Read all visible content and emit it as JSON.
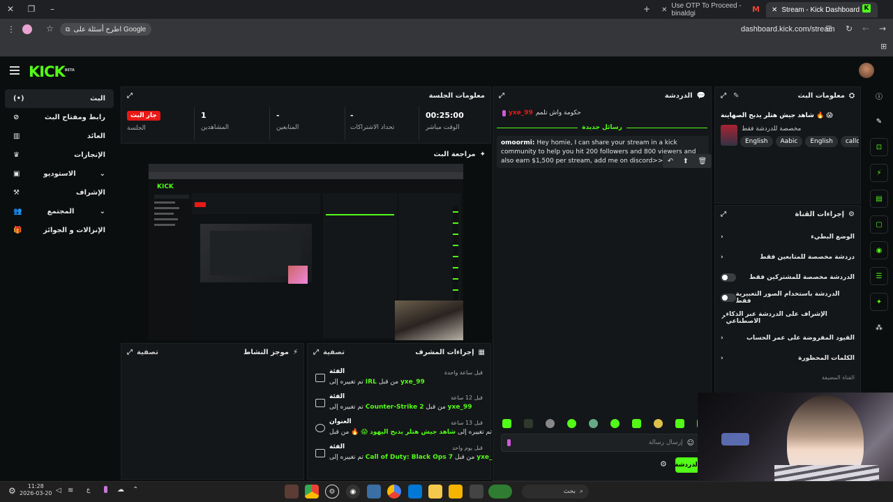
{
  "browser": {
    "tabs": [
      {
        "title": "Use OTP To Proceed - binaldgi"
      },
      {
        "title": "Stream - Kick Dashboard"
      }
    ],
    "google_chip": "اطرح أسئلة على Google",
    "url": "dashboard.kick.com/stream"
  },
  "brand": {
    "logo": "KICK",
    "beta": "BETA",
    "accent": "#53fc18"
  },
  "sidebar": {
    "items": [
      {
        "label": "البث",
        "icon": "broadcast-icon"
      },
      {
        "label": "رابط ومفتاح البث",
        "icon": "link-icon"
      },
      {
        "label": "العائد",
        "icon": "revenue-icon"
      },
      {
        "label": "الإنجازات",
        "icon": "trophy-icon"
      },
      {
        "label": "الاستوديو",
        "icon": "studio-icon"
      },
      {
        "label": "الإشراف",
        "icon": "gavel-icon"
      },
      {
        "label": "المجتمع",
        "icon": "community-icon"
      },
      {
        "label": "الإنزالات و الجوائز",
        "icon": "gift-icon"
      }
    ]
  },
  "session": {
    "title": "معلومات الجلسة",
    "live_badge": "جار البث",
    "session_label": "الجلسة",
    "viewers_value": "1",
    "viewers_label": "المشاهدين",
    "followers_value": "-",
    "followers_label": "المتابعين",
    "subs_value": "-",
    "subs_label": "تحداد الاشتراكات",
    "time_value": "00:25:00",
    "time_label": "الوقت مباشر"
  },
  "preview": {
    "title": "مراجعة البث"
  },
  "activity": {
    "title": "موجز النشاط",
    "filter": "تصفية"
  },
  "mod_actions": {
    "title": "إجراءات المشرف",
    "filter": "تصفية",
    "rows": [
      {
        "heading": "الفئة",
        "time": "قبل ساعة واحدة",
        "prefix": "تم تغييره إلى",
        "value": "IRL",
        "by": "من قبل",
        "user": "yxe_99"
      },
      {
        "heading": "الفئة",
        "time": "قبل 12 ساعة",
        "prefix": "تم تغييره إلى",
        "value": "Counter-Strike 2",
        "by": "من قبل",
        "user": "yxe_99"
      },
      {
        "heading": "العنوان",
        "time": "قبل 13 ساعة",
        "prefix": "تم تغييره إلى",
        "value": "شاهد جيش هتلر يذبح اليهود 😱 🔥",
        "by": "من قبل",
        "user": "yxe_99"
      },
      {
        "heading": "الفئة",
        "time": "قبل يوم واحد",
        "prefix": "تم تغييره إلى",
        "value": "Call of Duty: Black Ops 7",
        "by": "من قبل",
        "user": "yxe_99"
      }
    ]
  },
  "chat": {
    "title": "الدردشة",
    "first_user": "yxe_99",
    "first_msg": "حكومة واش تلمم",
    "new_messages": "رسائل جديدة",
    "msg_user": "omoormi:",
    "msg_text": "Hey homie, I can share your stream in a kick community to help you hit 200 followers and 800 viewers and also earn $1,500 per stream, add me on discord>>> done_111",
    "input_placeholder": "إرسال رسالة",
    "send_label": "الدردشة"
  },
  "stream_info": {
    "title": "معلومات البث",
    "stream_title": "شاهد جيش هتلر يذبح الصهاينة 🔥 😱",
    "subtitle": "مخصصة للدردشة فقط",
    "tags": [
      "English",
      "Aabic",
      "English",
      "callo"
    ]
  },
  "channel_actions": {
    "title": "إجراءات القناة",
    "items": [
      {
        "label": "الوضع البطيء",
        "control": "chevron"
      },
      {
        "label": "دردشة مخصصة للمتابعين فقط",
        "control": "chevron"
      },
      {
        "label": "الدردشة مخصصة للمشتركين فقط",
        "control": "toggle"
      },
      {
        "label": "الدردشة باستخدام الصور التعبيرية فقط",
        "control": "toggle"
      },
      {
        "label": "الإشراف على الدردشة عبر الذكاء الاصطناعي",
        "control": "external"
      },
      {
        "label": "القيود المفروضة على عمر الحساب",
        "control": "chevron"
      },
      {
        "label": "الكلمات المحظورة",
        "control": "chevron"
      }
    ],
    "footer_hint": "القناة المضيفة"
  },
  "taskbar": {
    "time": "11:28",
    "date": "2026-03-20",
    "search": "بحث",
    "lang": "ع"
  }
}
